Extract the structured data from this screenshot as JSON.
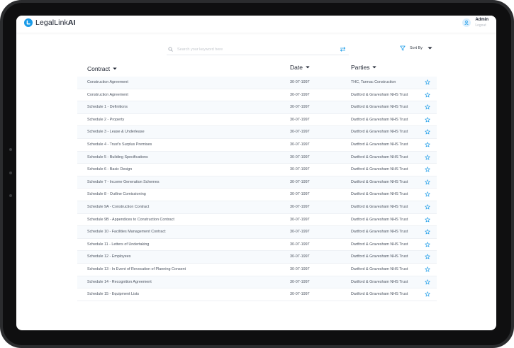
{
  "app": {
    "logo_prefix": "LegalLink",
    "logo_suffix": "AI",
    "user_name": "Admin",
    "user_action": "Logout",
    "accent_color": "#1a9be8"
  },
  "search": {
    "placeholder": "Search your keyword here",
    "value": ""
  },
  "sort": {
    "label": "Sort By"
  },
  "table": {
    "columns": [
      "Contract",
      "Date",
      "Parties"
    ],
    "rows": [
      {
        "contract": "Construction Agreement",
        "date": "30-07-1997",
        "parties": "THC, Tarmac Construction"
      },
      {
        "contract": "Construction Agreement",
        "date": "30-07-1997",
        "parties": "Dartford & Gravesham NHS Trust"
      },
      {
        "contract": "Schedule 1 - Definitions",
        "date": "30-07-1997",
        "parties": "Dartford & Gravesham NHS Trust"
      },
      {
        "contract": "Schedule 2 - Property",
        "date": "30-07-1997",
        "parties": "Dartford & Gravesham NHS Trust"
      },
      {
        "contract": "Schedule 3 - Lease & Underlease",
        "date": "30-07-1997",
        "parties": "Dartford & Gravesham NHS Trust"
      },
      {
        "contract": "Schedule 4 - Trust's Surplus Premises",
        "date": "30-07-1997",
        "parties": "Dartford & Gravesham NHS Trust"
      },
      {
        "contract": "Schedule 5 - Building Specifications",
        "date": "30-07-1997",
        "parties": "Dartford & Gravesham NHS Trust"
      },
      {
        "contract": "Schedule 6 - Basic Design",
        "date": "30-07-1997",
        "parties": "Dartford & Gravesham NHS Trust"
      },
      {
        "contract": "Schedule 7 - Income Generation Schemes",
        "date": "30-07-1997",
        "parties": "Dartford & Gravesham NHS Trust"
      },
      {
        "contract": "Schedule 8 - Outline Comissioning",
        "date": "30-07-1997",
        "parties": "Dartford & Gravesham NHS Trust"
      },
      {
        "contract": "Schedule 9A - Construction Contract",
        "date": "30-07-1997",
        "parties": "Dartford & Gravesham NHS Trust"
      },
      {
        "contract": "Schedule 9B - Appendices to Construction Contract",
        "date": "30-07-1997",
        "parties": "Dartford & Gravesham NHS Trust"
      },
      {
        "contract": "Schedule 10 - Facilities Management Contract",
        "date": "30-07-1997",
        "parties": "Dartford & Gravesham NHS Trust"
      },
      {
        "contract": "Schedule 11 - Letters of Undertaking",
        "date": "30-07-1997",
        "parties": "Dartford & Gravesham NHS Trust"
      },
      {
        "contract": "Schedule 12 - Employees",
        "date": "30-07-1997",
        "parties": "Dartford & Gravesham NHS Trust"
      },
      {
        "contract": "Schedule 13 - In Event of Revocation of Planning Consent",
        "date": "30-07-1997",
        "parties": "Dartford & Gravesham NHS Trust"
      },
      {
        "contract": "Schedule 14 - Recognition Agreement",
        "date": "30-07-1997",
        "parties": "Dartford & Gravesham NHS Trust"
      },
      {
        "contract": "Schedule 15 - Equipment Lists",
        "date": "30-07-1997",
        "parties": "Dartford & Gravesham NHS Trust"
      }
    ]
  },
  "icons": {
    "logo": "logo-icon",
    "user": "user-icon",
    "search": "search-icon",
    "swap": "swap-icon",
    "filter": "filter-icon",
    "caret": "caret-down-icon",
    "favorite": "star-icon"
  }
}
